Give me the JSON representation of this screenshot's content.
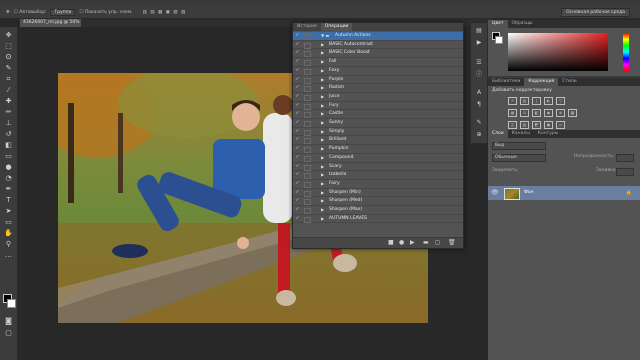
{
  "options_bar": {
    "auto_select": "Автовыбор:",
    "group": "Группа",
    "show_controls": "Показать упр. элем.",
    "workspace": "Основная рабочая среда"
  },
  "document_tab": "43626007_ml.jpg @ 50% (RGB/8)",
  "actions_panel": {
    "tabs": [
      "История",
      "Операции"
    ],
    "active_tab": "Операции",
    "set_name": "Autumn Actions",
    "actions": [
      "BASIC Autocontrast",
      "BASIC Color Boost",
      "Fall",
      "Foxy",
      "Purple",
      "Radish",
      "Juice",
      "Fury",
      "Castle",
      "Sunny",
      "Simply",
      "Brilliant",
      "Pumpkin",
      "Compound",
      "Scary",
      "Izabella",
      "Fairy",
      "Sharpen (Min)",
      "Sharpen (Med)",
      "Sharpen (Max)",
      "AUTUMN LEAVES"
    ]
  },
  "color_panel": {
    "tabs": [
      "Цвет",
      "Образцы"
    ],
    "picker_hue": "#e32020"
  },
  "adjustments_panel": {
    "tabs": [
      "Библиотеки",
      "Коррекция",
      "Стили"
    ],
    "title": "Добавить корректировку"
  },
  "layers_panel": {
    "tabs": [
      "Слои",
      "Каналы",
      "Контуры"
    ],
    "kind_filter": "Вид",
    "blend_mode": "Обычные",
    "opacity_label": "Непрозрачность:",
    "lock_label": "Закрепить:",
    "fill_label": "Заливка:",
    "layer_name": "Фон"
  },
  "colors": {
    "selection": "#3d6ea8",
    "panel": "#535353",
    "dark": "#282828"
  }
}
